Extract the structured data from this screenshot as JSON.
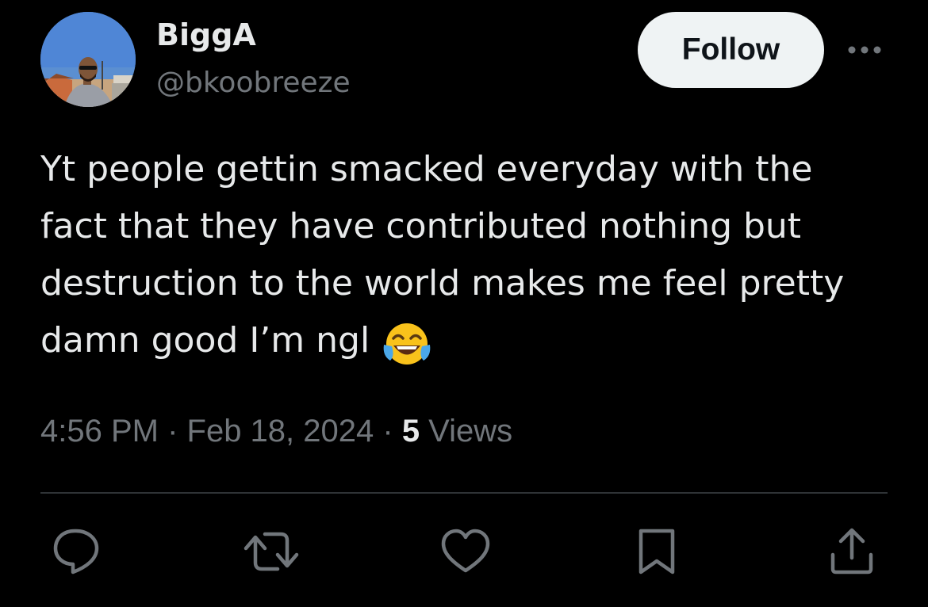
{
  "author": {
    "display_name": "BiggA",
    "handle": "@bkoobreeze",
    "avatar_icon": "profile-photo"
  },
  "follow_button": {
    "label": "Follow"
  },
  "more_menu": {
    "icon": "more-horizontal-icon"
  },
  "tweet": {
    "text": "Yt people gettin smacked everyday with the\nfact that they have contributed nothing but\ndestruction to the world makes me feel pretty\ndamn good I’m ngl",
    "emoji_icon": "face-with-tears-of-joy-emoji",
    "time": "4:56 PM",
    "separator": " · ",
    "date": "Feb 18, 2024",
    "views_count": "5",
    "views_label": " Views"
  },
  "actions": [
    {
      "name": "reply",
      "icon": "reply-icon"
    },
    {
      "name": "retweet",
      "icon": "retweet-icon"
    },
    {
      "name": "like",
      "icon": "heart-icon"
    },
    {
      "name": "bookmark",
      "icon": "bookmark-icon"
    },
    {
      "name": "share",
      "icon": "share-icon"
    }
  ],
  "colors": {
    "background": "#000000",
    "primary_text": "#e7e9ea",
    "secondary_text": "#71767b",
    "follow_bg": "#eff3f4",
    "follow_text": "#0f1419",
    "divider": "#2f3336"
  }
}
